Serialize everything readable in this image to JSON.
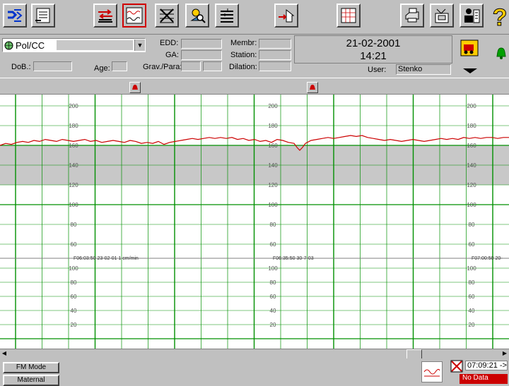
{
  "toolbar": {
    "buttons": [
      {
        "icon": "signal-in-icon",
        "active": false
      },
      {
        "icon": "transfer-icon",
        "active": false
      },
      {
        "icon": "bed-arrows-icon",
        "active": false
      },
      {
        "icon": "trace-view-icon",
        "active": true
      },
      {
        "icon": "chart-cross-icon",
        "active": false
      },
      {
        "icon": "search-person-icon",
        "active": false
      },
      {
        "icon": "list-edit-icon",
        "active": false
      },
      {
        "icon": "house-arrow-icon",
        "active": false
      },
      {
        "icon": "grid-report-icon",
        "active": false
      },
      {
        "icon": "printer-icon",
        "active": false
      },
      {
        "icon": "archive-icon",
        "active": false
      },
      {
        "icon": "user-settings-icon",
        "active": false
      },
      {
        "icon": "help-icon",
        "active": false
      }
    ]
  },
  "patient": {
    "name_value": "Pol/CC",
    "labels": {
      "dob": "DoB.:",
      "age": "Age:",
      "edd": "EDD:",
      "ga": "GA:",
      "gravpara": "Grav./Para:",
      "membr": "Membr:",
      "station": "Station:",
      "dilation": "Dilation:"
    }
  },
  "datetime": {
    "date": "21-02-2001",
    "time": "14:21"
  },
  "user": {
    "label": "User:",
    "value": "Stenko"
  },
  "colors": {
    "trace": "#cc0000",
    "grid": "#009000",
    "band": "#c8c8c8",
    "alarm": "#00a000"
  },
  "chart_data": {
    "type": "line",
    "fhr": {
      "ylim": [
        60,
        200
      ],
      "ticks": [
        "200",
        "180",
        "160",
        "140",
        "120",
        "100",
        "80",
        "60"
      ],
      "normal_band": [
        120,
        160
      ],
      "x": [
        0,
        8,
        16,
        24,
        32,
        40,
        48,
        56,
        64,
        72,
        80,
        88,
        96,
        104,
        112,
        120,
        128,
        136,
        144,
        152,
        160,
        168,
        176,
        184,
        192,
        200,
        208,
        216,
        224,
        232,
        240,
        248,
        256,
        264,
        272,
        280,
        288,
        296,
        304,
        312,
        320,
        328,
        336,
        344,
        352,
        360,
        368,
        376,
        384,
        392,
        400,
        408,
        416,
        420,
        424,
        428,
        432,
        440,
        448,
        456,
        464,
        472,
        480,
        488,
        496,
        504,
        512,
        520,
        528,
        536,
        544,
        552,
        560,
        568,
        576,
        584,
        592,
        600,
        608,
        616,
        624,
        632,
        640,
        648,
        656,
        664,
        672,
        680,
        688,
        696,
        704,
        712,
        720
      ],
      "y": [
        160,
        162,
        161,
        163,
        164,
        163,
        165,
        164,
        166,
        165,
        164,
        166,
        165,
        164,
        165,
        166,
        164,
        165,
        163,
        164,
        165,
        164,
        163,
        165,
        164,
        162,
        163,
        162,
        164,
        161,
        163,
        164,
        165,
        166,
        167,
        166,
        167,
        168,
        167,
        168,
        167,
        168,
        166,
        167,
        165,
        166,
        164,
        165,
        163,
        166,
        165,
        163,
        162,
        158,
        155,
        158,
        162,
        165,
        166,
        167,
        168,
        167,
        168,
        169,
        170,
        169,
        170,
        168,
        167,
        166,
        165,
        166,
        165,
        164,
        165,
        166,
        165,
        164,
        165,
        166,
        167,
        166,
        167,
        166,
        168,
        167,
        168,
        167,
        168,
        168,
        167,
        168,
        168
      ]
    },
    "uc": {
      "ylim": [
        0,
        100
      ],
      "ticks": [
        "100",
        "80",
        "60",
        "40",
        "20"
      ]
    },
    "annotations": [
      {
        "text": "F06:03:50 23-02-01 1 cm/min"
      },
      {
        "text": "F06:35:50 30-7-03"
      },
      {
        "text": "F07:00:50 20-"
      }
    ]
  },
  "bottom": {
    "mode_button": "FM Mode",
    "second_button": "Maternal",
    "clock": "07:09:21 ->",
    "status": "No Data"
  }
}
